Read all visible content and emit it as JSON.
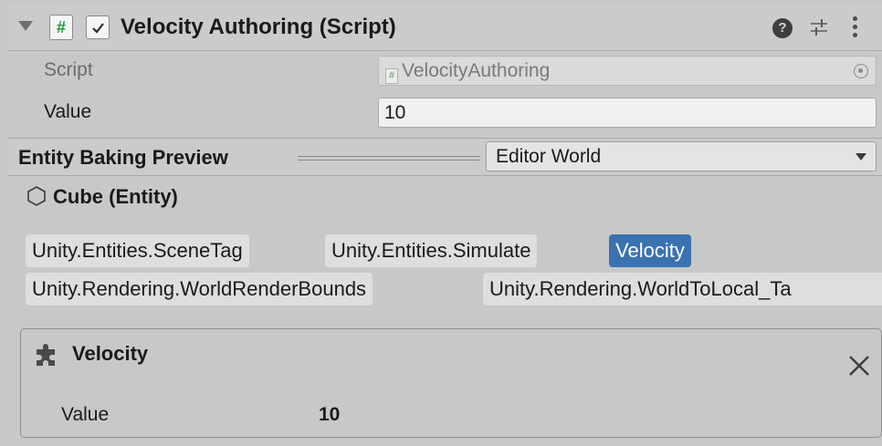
{
  "component": {
    "title": "Velocity Authoring (Script)",
    "script_icon": "#",
    "enabled": true
  },
  "fields": {
    "script_label": "Script",
    "script_value": "VelocityAuthoring",
    "value_label": "Value",
    "value_value": "10"
  },
  "baking": {
    "title": "Entity Baking Preview",
    "world": "Editor World"
  },
  "entity": {
    "name": "Cube (Entity)"
  },
  "tags": [
    {
      "label": "Unity.Entities.SceneTag",
      "selected": false
    },
    {
      "label": "Unity.Entities.Simulate",
      "selected": false
    },
    {
      "label": "Velocity",
      "selected": true
    },
    {
      "label": "Unity.Rendering.WorldRenderBounds",
      "selected": false
    },
    {
      "label": "Unity.Rendering.WorldToLocal_Ta",
      "selected": false
    }
  ],
  "card": {
    "title": "Velocity",
    "field_label": "Value",
    "field_value": "10"
  },
  "colors": {
    "selected_tag": "#3a72b0",
    "script_hash": "#1c9a3b"
  }
}
